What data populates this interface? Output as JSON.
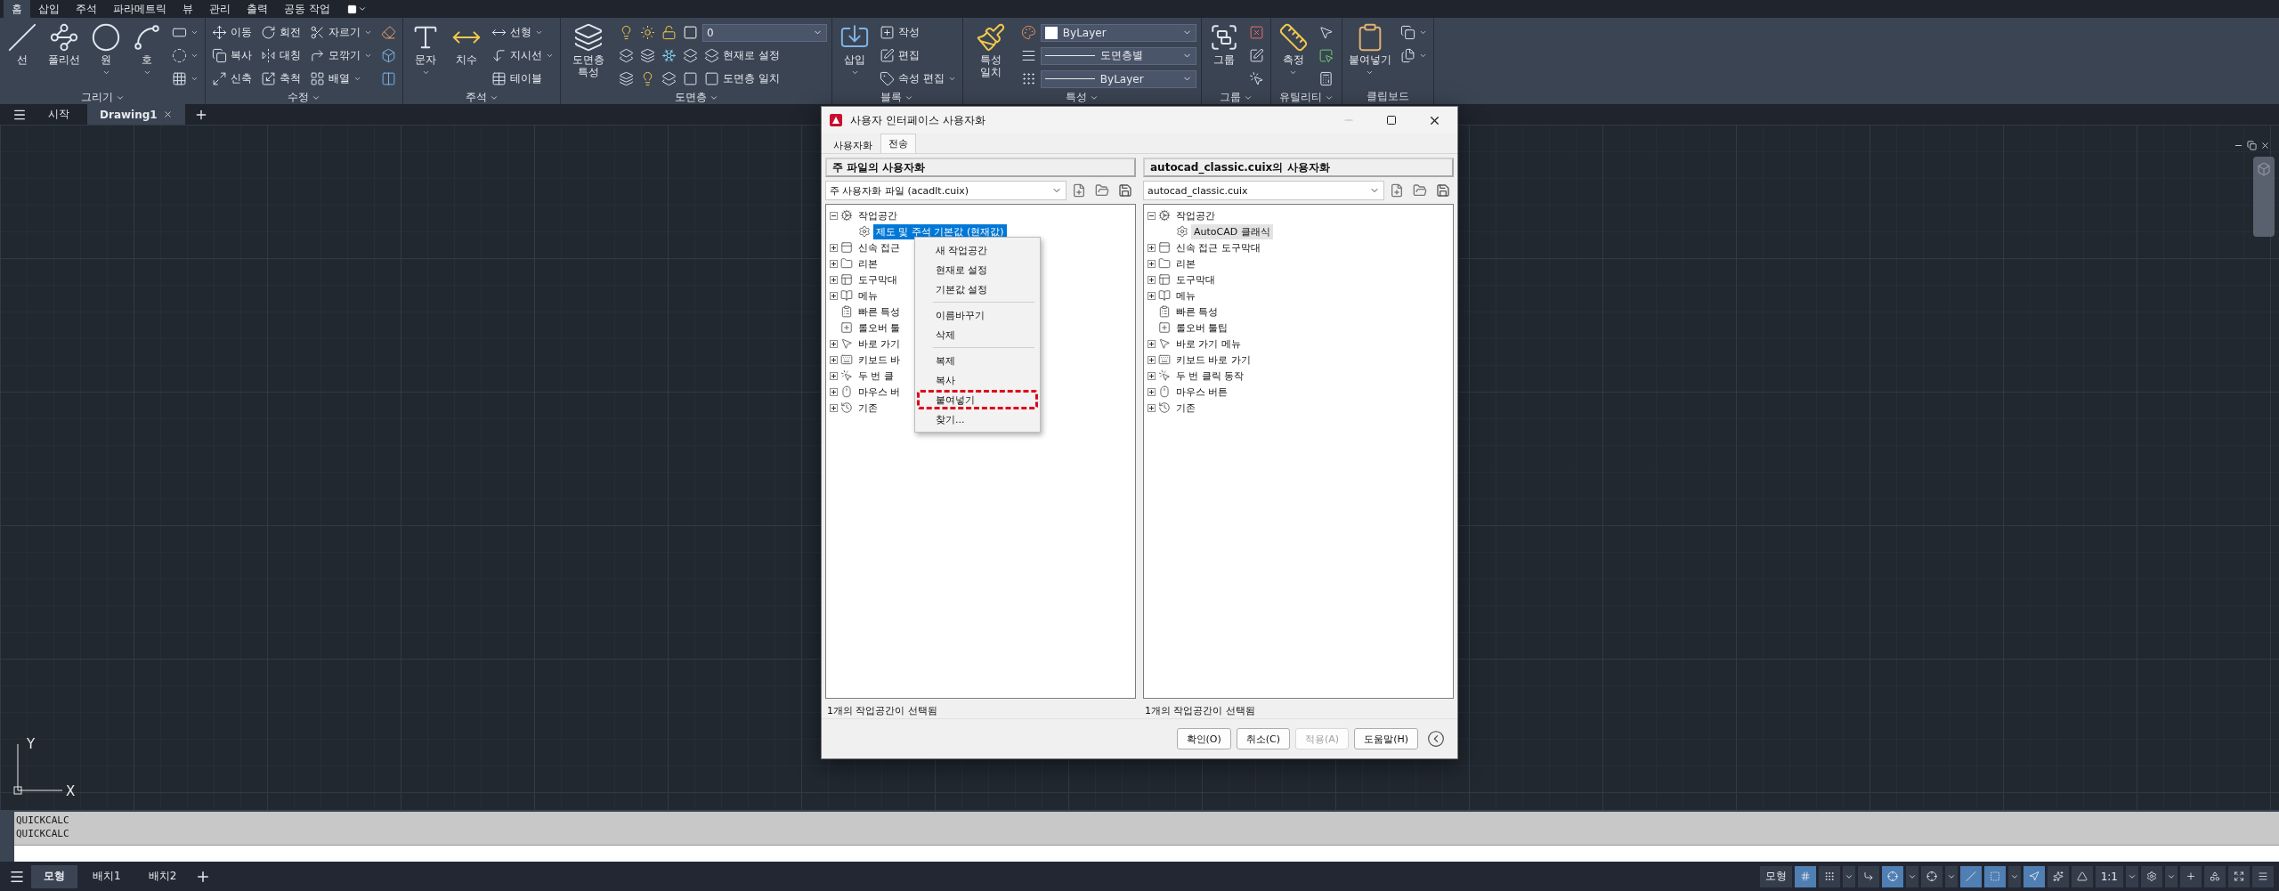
{
  "ribbon": {
    "tabs": [
      {
        "label": "홈",
        "selected": true
      },
      {
        "label": "삽입",
        "selected": false
      },
      {
        "label": "주석",
        "selected": false
      },
      {
        "label": "파라메트릭",
        "selected": false
      },
      {
        "label": "뷰",
        "selected": false
      },
      {
        "label": "관리",
        "selected": false
      },
      {
        "label": "출력",
        "selected": false
      },
      {
        "label": "공동 작업",
        "selected": false
      }
    ],
    "panels": [
      {
        "title": "그리기",
        "has_menu": true,
        "large": [
          {
            "label": "선",
            "caret": false
          },
          {
            "label": "폴리선",
            "caret": false
          },
          {
            "label": "원",
            "caret": true
          },
          {
            "label": "호",
            "caret": true
          }
        ],
        "columns": [
          [
            [
              {
                "kind": "tool",
                "caret": true
              }
            ],
            [
              {
                "kind": "tool",
                "caret": true
              }
            ],
            [
              {
                "kind": "tool",
                "caret": true
              }
            ]
          ]
        ]
      },
      {
        "title": "수정",
        "has_menu": true,
        "columns": [
          [
            [
              {
                "kind": "tool",
                "label": "이동",
                "caret": false
              }
            ],
            [
              {
                "kind": "tool",
                "label": "복사",
                "caret": false
              }
            ],
            [
              {
                "kind": "tool",
                "label": "신축",
                "caret": false
              }
            ]
          ],
          [
            [
              {
                "kind": "tool",
                "label": "회전",
                "caret": false
              }
            ],
            [
              {
                "kind": "tool",
                "label": "대칭",
                "caret": false
              }
            ],
            [
              {
                "kind": "tool",
                "label": "축척",
                "caret": false
              }
            ]
          ],
          [
            [
              {
                "kind": "tool",
                "label": "자르기",
                "caret": true
              }
            ],
            [
              {
                "kind": "tool",
                "label": "모깎기",
                "caret": true
              }
            ],
            [
              {
                "kind": "tool",
                "label": "배열",
                "caret": true
              }
            ]
          ],
          [
            [
              {
                "kind": "tool",
                "caret": false
              }
            ],
            [
              {
                "kind": "tool",
                "caret": false
              }
            ],
            [
              {
                "kind": "tool",
                "caret": false
              }
            ]
          ]
        ]
      },
      {
        "title": "주석",
        "has_menu": true,
        "large": [
          {
            "label": "문자",
            "caret": true
          },
          {
            "label": "치수",
            "caret": false
          }
        ],
        "columns": [
          [
            [
              {
                "kind": "tool",
                "label": "선형",
                "caret": true
              }
            ],
            [
              {
                "kind": "tool",
                "label": "지시선",
                "caret": true
              }
            ],
            [
              {
                "kind": "tool",
                "label": "테이블",
                "caret": false
              }
            ]
          ]
        ]
      },
      {
        "title": "도면층",
        "has_menu": true,
        "large": [
          {
            "label": "도면층 특성",
            "caret": false
          }
        ],
        "columns": [
          [
            [
              {
                "kind": "tool",
                "caret": false
              },
              {
                "kind": "tool",
                "caret": false
              },
              {
                "kind": "tool",
                "caret": false
              },
              {
                "kind": "tool",
                "caret": false
              },
              {
                "kind": "combo",
                "value": "0",
                "swatch": false,
                "line_sample": false
              }
            ],
            [
              {
                "kind": "tool",
                "caret": false
              },
              {
                "kind": "tool",
                "caret": false
              },
              {
                "kind": "tool",
                "caret": false
              },
              {
                "kind": "tool",
                "caret": false
              },
              {
                "kind": "tool",
                "label": "현재로 설정",
                "caret": false
              }
            ],
            [
              {
                "kind": "tool",
                "caret": false
              },
              {
                "kind": "tool",
                "caret": false
              },
              {
                "kind": "tool",
                "caret": false
              },
              {
                "kind": "tool",
                "caret": false
              },
              {
                "kind": "tool",
                "label": "도면층 일치",
                "caret": false
              }
            ]
          ]
        ]
      },
      {
        "title": "블록",
        "has_menu": true,
        "large": [
          {
            "label": "삽입",
            "caret": true
          }
        ],
        "columns": [
          [
            [
              {
                "kind": "tool",
                "label": "작성",
                "caret": false
              }
            ],
            [
              {
                "kind": "tool",
                "label": "편집",
                "caret": false
              }
            ],
            [
              {
                "kind": "tool",
                "label": "속성 편집",
                "caret": true
              }
            ]
          ]
        ]
      },
      {
        "title": "특성",
        "has_menu": true,
        "large": [
          {
            "label": "특성 일치",
            "caret": false
          }
        ],
        "columns": [
          [
            [
              {
                "kind": "tool",
                "caret": false
              },
              {
                "kind": "combo",
                "value": "ByLayer",
                "swatch": true,
                "line_sample": false
              }
            ],
            [
              {
                "kind": "tool",
                "caret": false
              },
              {
                "kind": "combo",
                "value": "도면층별",
                "swatch": false,
                "line_sample": true
              }
            ],
            [
              {
                "kind": "tool",
                "caret": false
              },
              {
                "kind": "combo",
                "value": "ByLayer",
                "swatch": false,
                "line_sample": true
              }
            ]
          ]
        ]
      },
      {
        "title": "그룹",
        "has_menu": true,
        "large": [
          {
            "label": "그룹",
            "caret": false
          }
        ],
        "columns": [
          [
            [
              {
                "kind": "tool",
                "caret": false
              }
            ],
            [
              {
                "kind": "tool",
                "caret": false
              }
            ],
            [
              {
                "kind": "tool",
                "caret": false
              }
            ]
          ]
        ]
      },
      {
        "title": "유틸리티",
        "has_menu": true,
        "large": [
          {
            "label": "측정",
            "caret": true
          }
        ],
        "columns": [
          [
            [
              {
                "kind": "tool",
                "caret": false
              }
            ],
            [
              {
                "kind": "tool",
                "caret": false
              }
            ],
            [
              {
                "kind": "tool",
                "caret": false
              }
            ]
          ]
        ]
      },
      {
        "title": "클립보드",
        "has_menu": false,
        "large": [
          {
            "label": "붙여넣기",
            "caret": true
          }
        ],
        "columns": [
          [
            [
              {
                "kind": "tool",
                "caret": true
              }
            ],
            [
              {
                "kind": "tool",
                "caret": true
              }
            ]
          ]
        ]
      }
    ]
  },
  "doc_tabs": [
    {
      "label": "시작",
      "selected": false,
      "closable": false
    },
    {
      "label": "Drawing1",
      "selected": true,
      "closable": true
    }
  ],
  "canvas": {
    "ucs": {
      "x_label": "X",
      "y_label": "Y"
    }
  },
  "command_line": {
    "history": [
      "QUICKCALC",
      "QUICKCALC"
    ]
  },
  "layout_tabs": [
    {
      "label": "모형",
      "selected": true
    },
    {
      "label": "배치1",
      "selected": false
    },
    {
      "label": "배치2",
      "selected": false
    }
  ],
  "status_bar": [
    {
      "kind": "label",
      "label": "모형"
    },
    {
      "kind": "icon",
      "on": true
    },
    {
      "kind": "icon",
      "on": false
    },
    {
      "kind": "caret"
    },
    {
      "kind": "icon",
      "on": false
    },
    {
      "kind": "icon",
      "on": true
    },
    {
      "kind": "caret"
    },
    {
      "kind": "icon",
      "on": false
    },
    {
      "kind": "caret"
    },
    {
      "kind": "icon",
      "on": true
    },
    {
      "kind": "icon",
      "on": true
    },
    {
      "kind": "caret"
    },
    {
      "kind": "icon",
      "on": true
    },
    {
      "kind": "icon",
      "on": false
    },
    {
      "kind": "icon",
      "on": false
    },
    {
      "kind": "label",
      "label": "1:1"
    },
    {
      "kind": "caret"
    },
    {
      "kind": "icon",
      "on": false
    },
    {
      "kind": "caret"
    },
    {
      "kind": "icon",
      "on": false
    },
    {
      "kind": "icon",
      "on": false
    },
    {
      "kind": "icon",
      "on": false
    },
    {
      "kind": "icon",
      "on": false
    }
  ],
  "dialog": {
    "title": "사용자 인터페이스 사용자화",
    "tabs": [
      {
        "label": "사용자화",
        "selected": false
      },
      {
        "label": "전송",
        "selected": true
      }
    ],
    "panes": [
      {
        "header": "주 파일의 사용자화",
        "file": "주 사용자화 파일 (acadlt.cuix)",
        "focused": true,
        "status": "1개의 작업공간이 선택됨",
        "tree": [
          {
            "label": "작업공간",
            "expanded": true,
            "selected": false,
            "children": [
              {
                "label": "제도 및 주석 기본값 (현재값)",
                "selected": true
              }
            ]
          },
          {
            "label": "신속 접근",
            "expanded": false,
            "selected": false
          },
          {
            "label": "리본",
            "expanded": false,
            "selected": false
          },
          {
            "label": "도구막대",
            "expanded": false,
            "selected": false
          },
          {
            "label": "메뉴",
            "expanded": false,
            "selected": false
          },
          {
            "label": "빠른 특성",
            "selected": false
          },
          {
            "label": "롤오버 툴",
            "selected": false
          },
          {
            "label": "바로 가기",
            "expanded": false,
            "selected": false
          },
          {
            "label": "키보드 바",
            "expanded": false,
            "selected": false
          },
          {
            "label": "두 번 클",
            "expanded": false,
            "selected": false
          },
          {
            "label": "마우스 버",
            "expanded": false,
            "selected": false
          },
          {
            "label": "기존",
            "expanded": false,
            "selected": false
          }
        ]
      },
      {
        "header": "autocad_classic.cuix의 사용자화",
        "file": "autocad_classic.cuix",
        "focused": false,
        "status": "1개의 작업공간이 선택됨",
        "tree": [
          {
            "label": "작업공간",
            "expanded": true,
            "selected": false,
            "children": [
              {
                "label": "AutoCAD 클래식",
                "selected": true
              }
            ]
          },
          {
            "label": "신속 접근 도구막대",
            "expanded": false,
            "selected": false
          },
          {
            "label": "리본",
            "expanded": false,
            "selected": false
          },
          {
            "label": "도구막대",
            "expanded": false,
            "selected": false
          },
          {
            "label": "메뉴",
            "expanded": false,
            "selected": false
          },
          {
            "label": "빠른 특성",
            "selected": false
          },
          {
            "label": "롤오버 툴팁",
            "selected": false
          },
          {
            "label": "바로 가기 메뉴",
            "expanded": false,
            "selected": false
          },
          {
            "label": "키보드 바로 가기",
            "expanded": false,
            "selected": false
          },
          {
            "label": "두 번 클릭 동작",
            "expanded": false,
            "selected": false
          },
          {
            "label": "마우스 버튼",
            "expanded": false,
            "selected": false
          },
          {
            "label": "기존",
            "expanded": false,
            "selected": false
          }
        ]
      }
    ],
    "context_menu": [
      {
        "kind": "item",
        "label": "새 작업공간",
        "highlighted": false
      },
      {
        "kind": "item",
        "label": "현재로 설정",
        "highlighted": false
      },
      {
        "kind": "item",
        "label": "기본값 설정",
        "highlighted": false
      },
      {
        "kind": "separator"
      },
      {
        "kind": "item",
        "label": "이름바꾸기",
        "highlighted": false
      },
      {
        "kind": "item",
        "label": "삭제",
        "highlighted": false
      },
      {
        "kind": "separator"
      },
      {
        "kind": "item",
        "label": "복제",
        "highlighted": false
      },
      {
        "kind": "item",
        "label": "복사",
        "highlighted": false
      },
      {
        "kind": "item",
        "label": "붙여넣기",
        "highlighted": true
      },
      {
        "kind": "item",
        "label": "찾기...",
        "highlighted": false
      }
    ],
    "buttons": [
      {
        "label": "확인(O)",
        "disabled": false
      },
      {
        "label": "취소(C)",
        "disabled": false
      },
      {
        "label": "적용(A)",
        "disabled": true
      },
      {
        "label": "도움말(H)",
        "disabled": false
      }
    ]
  }
}
